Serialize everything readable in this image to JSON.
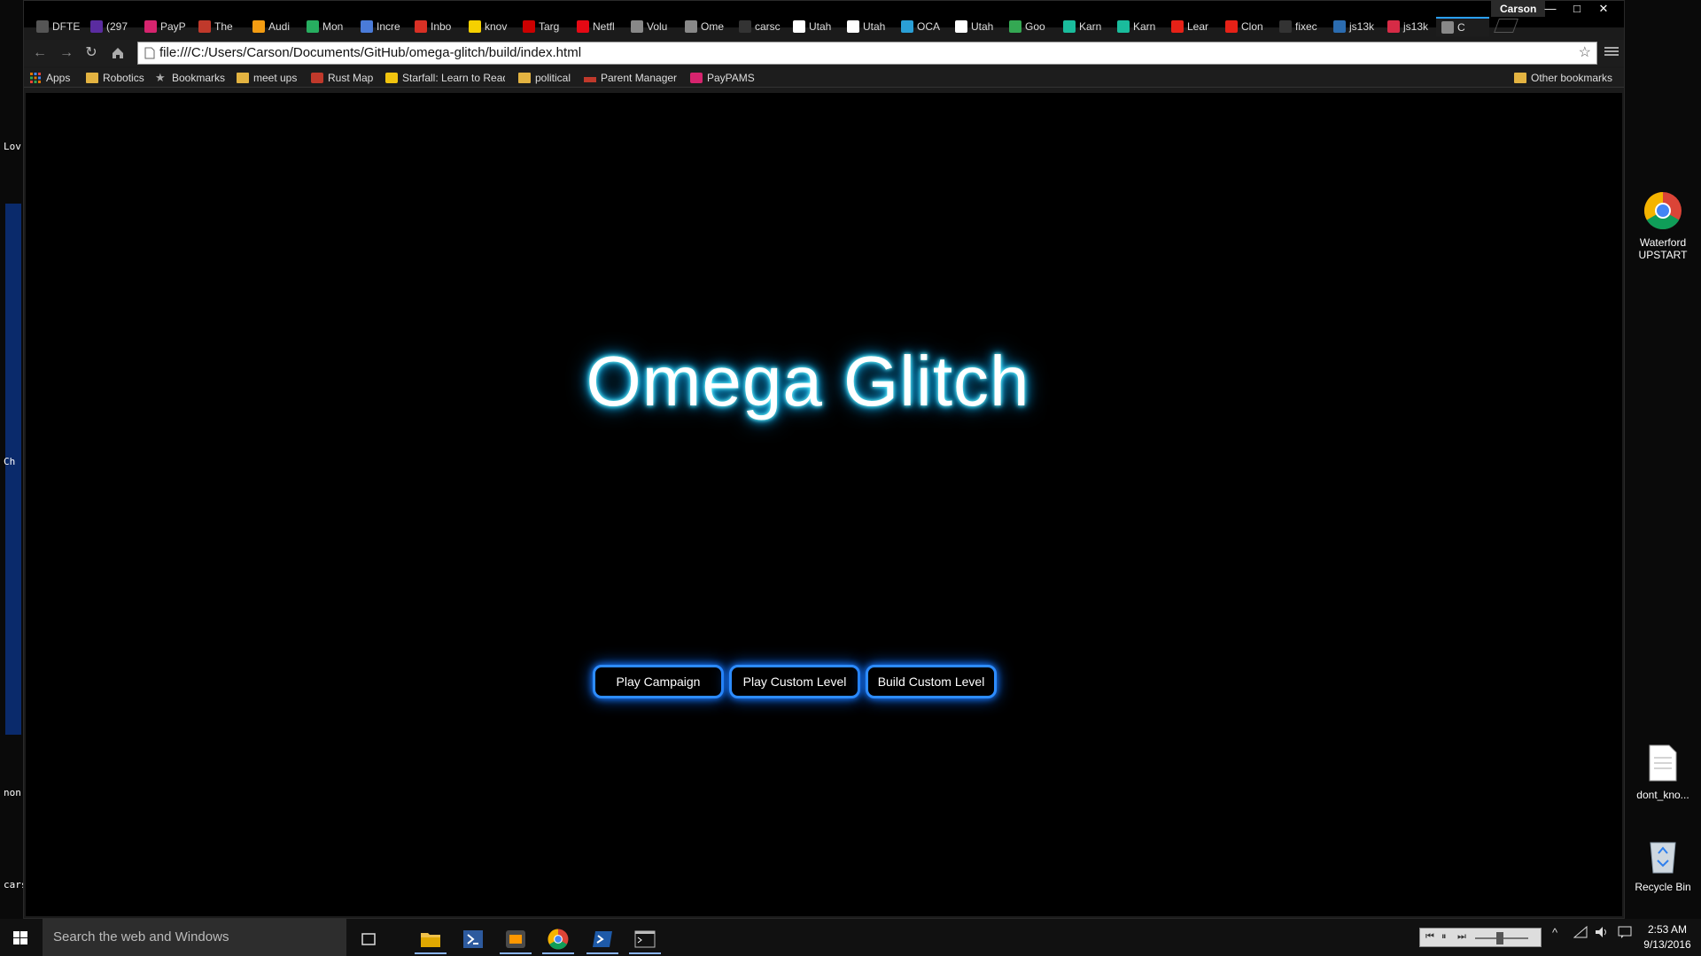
{
  "window": {
    "profile_name": "Carson",
    "tabs": [
      {
        "label": "DFTE",
        "color": "#555555"
      },
      {
        "label": "(297",
        "color": "#5a2ca0"
      },
      {
        "label": "PayP",
        "color": "#d6246e"
      },
      {
        "label": "The",
        "color": "#c0392b"
      },
      {
        "label": "Audi",
        "color": "#f39c12"
      },
      {
        "label": "Mon",
        "color": "#27ae60"
      },
      {
        "label": "Incre",
        "color": "#4a7bd8"
      },
      {
        "label": "Inbo",
        "color": "#d93025"
      },
      {
        "label": "knov",
        "color": "#f5d000"
      },
      {
        "label": "Targ",
        "color": "#cc0000"
      },
      {
        "label": "Netfl",
        "color": "#e50914"
      },
      {
        "label": "Volu",
        "color": "#888888"
      },
      {
        "label": "Ome",
        "color": "#888888"
      },
      {
        "label": "carsc",
        "color": "#333333"
      },
      {
        "label": "Utah",
        "color": "#ffffff"
      },
      {
        "label": "Utah",
        "color": "#ffffff"
      },
      {
        "label": "OCA",
        "color": "#2a9fd6"
      },
      {
        "label": "Utah",
        "color": "#ffffff"
      },
      {
        "label": "Goo",
        "color": "#34a853"
      },
      {
        "label": "Karn",
        "color": "#1abc9c"
      },
      {
        "label": "Karn",
        "color": "#1abc9c"
      },
      {
        "label": "Lear",
        "color": "#e62117"
      },
      {
        "label": "Clon",
        "color": "#e62117"
      },
      {
        "label": "fixec",
        "color": "#333333"
      },
      {
        "label": "js13k",
        "color": "#2b6cb0"
      },
      {
        "label": "js13k",
        "color": "#d62b46"
      },
      {
        "label": "C",
        "color": "#888888"
      }
    ],
    "controls": {
      "minimize": "—",
      "maximize": "□",
      "close": "✕"
    }
  },
  "toolbar": {
    "back_icon": "back-arrow-icon",
    "forward_icon": "forward-arrow-icon",
    "url": "file:///C:/Users/Carson/Documents/GitHub/omega-glitch/build/index.html"
  },
  "bookmarks": {
    "items": [
      {
        "label": "Apps",
        "icon": "apps-grid-icon"
      },
      {
        "label": "Robotics",
        "icon": "folder-icon"
      },
      {
        "label": "Bookmarks",
        "icon": "star-icon"
      },
      {
        "label": "meet ups",
        "icon": "folder-icon"
      },
      {
        "label": "Rust Map",
        "icon": "rust-icon"
      },
      {
        "label": "Starfall: Learn to Read",
        "icon": "star-icon"
      },
      {
        "label": "political",
        "icon": "folder-icon"
      },
      {
        "label": "Parent Manager",
        "icon": "page-icon"
      },
      {
        "label": "PayPAMS",
        "icon": "paypams-icon"
      }
    ],
    "other": "Other bookmarks"
  },
  "page": {
    "title": "Omega Glitch",
    "buttons": [
      "Play Campaign",
      "Play Custom Level",
      "Build Custom Level"
    ]
  },
  "desktop": {
    "icons_right": [
      {
        "label": "Waterford UPSTART",
        "icon": "chrome-icon"
      },
      {
        "label": "dont_kno...",
        "icon": "text-file-icon"
      },
      {
        "label": "Recycle Bin",
        "icon": "recycle-bin-icon"
      }
    ],
    "left_labels": [
      "Lov",
      "Ch",
      "non",
      "cars"
    ]
  },
  "taskbar": {
    "search_placeholder": "Search the web and Windows",
    "time": "2:53 AM",
    "date": "9/13/2016"
  }
}
